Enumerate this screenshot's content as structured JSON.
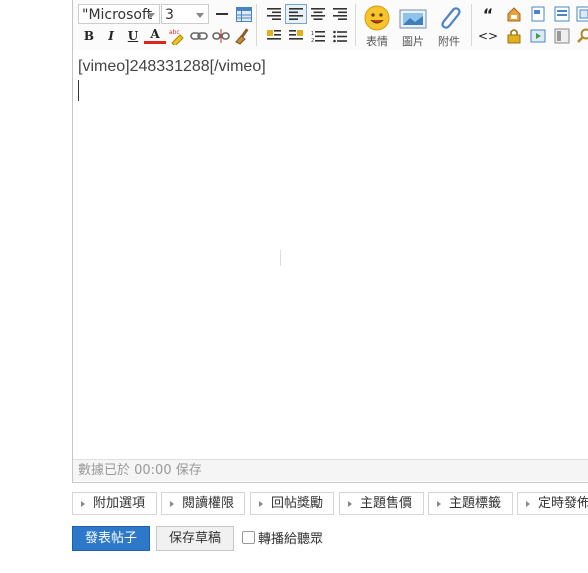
{
  "toolbar": {
    "font_select": "\"Microsoft",
    "size_select": "3",
    "bold": "B",
    "italic": "I",
    "underline": "U",
    "font_color": "A",
    "emoji_label": "表情",
    "image_label": "圖片",
    "attach_label": "附件",
    "quote_glyph": "“",
    "code_glyph": "<>"
  },
  "editor": {
    "content_line": "[vimeo]248331288[/vimeo]",
    "autosave_status": "數據已於 00:00 保存"
  },
  "tabs": [
    "附加選項",
    "閱讀權限",
    "回帖獎勵",
    "主題售價",
    "主題標籤",
    "定時發佈"
  ],
  "actions": {
    "submit_label": "發表帖子",
    "draft_label": "保存草稿",
    "forward_label": "轉播給聽眾"
  }
}
